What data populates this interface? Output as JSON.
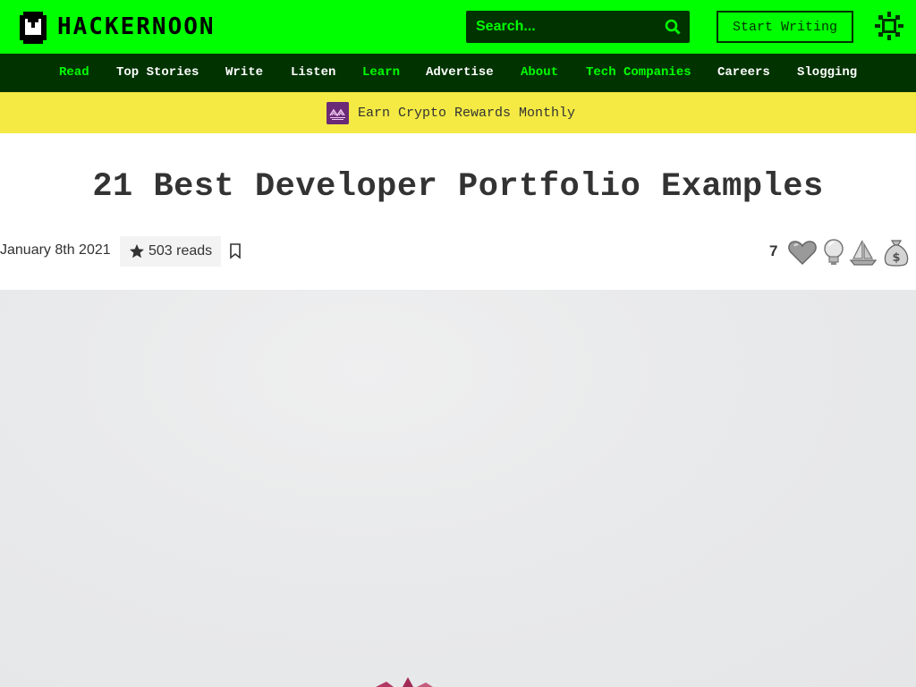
{
  "header": {
    "logo_text": "HACKERNOON",
    "search_placeholder": "Search...",
    "start_writing_label": "Start Writing"
  },
  "nav": {
    "items": [
      {
        "label": "Read",
        "color": "#00ff00"
      },
      {
        "label": "Top Stories",
        "color": "#ffffff"
      },
      {
        "label": "Write",
        "color": "#ffffff"
      },
      {
        "label": "Listen",
        "color": "#ffffff"
      },
      {
        "label": "Learn",
        "color": "#00ff00"
      },
      {
        "label": "Advertise",
        "color": "#ffffff"
      },
      {
        "label": "About",
        "color": "#00ff00"
      },
      {
        "label": "Tech Companies",
        "color": "#00ff00"
      },
      {
        "label": "Careers",
        "color": "#ffffff"
      },
      {
        "label": "Slogging",
        "color": "#ffffff"
      }
    ]
  },
  "banner": {
    "text": "Earn Crypto Rewards Monthly",
    "icon": "partner-logo-icon"
  },
  "article": {
    "title": "21 Best Developer Portfolio Examples",
    "date": "January 8th 2021",
    "reads": "503 reads",
    "reaction_count": "7",
    "reactions": [
      "heart-icon",
      "lightbulb-icon",
      "boat-icon",
      "money-bag-icon"
    ]
  },
  "colors": {
    "brand_green": "#00ff00",
    "dark_green": "#003300",
    "banner_yellow": "#f4ea43",
    "text": "#333333"
  }
}
